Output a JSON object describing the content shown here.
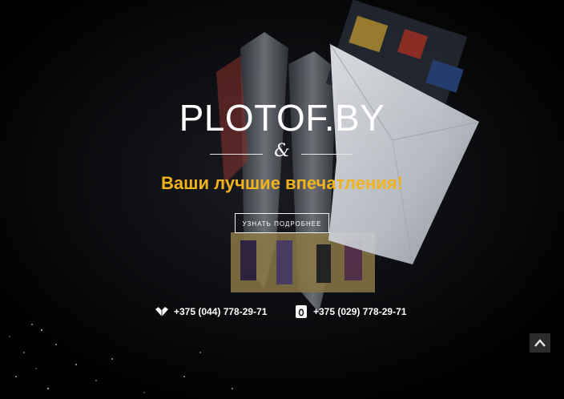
{
  "hero": {
    "title": "PLOTOF.BY",
    "ampersand": "&",
    "tagline": "Ваши лучшие впечатления!",
    "cta_label": "УЗНАТЬ ПОДРОБНЕЕ"
  },
  "contacts": [
    {
      "icon": "velcom-icon",
      "phone": "+375 (044) 778-29-71"
    },
    {
      "icon": "mts-icon",
      "phone": "+375 (029) 778-29-71"
    }
  ],
  "scroll_top": {
    "icon": "chevron-up-icon"
  },
  "colors": {
    "background": "#000000",
    "accent": "#f0b31b",
    "text": "#ffffff",
    "scroll_button": "#2c2c2c"
  }
}
